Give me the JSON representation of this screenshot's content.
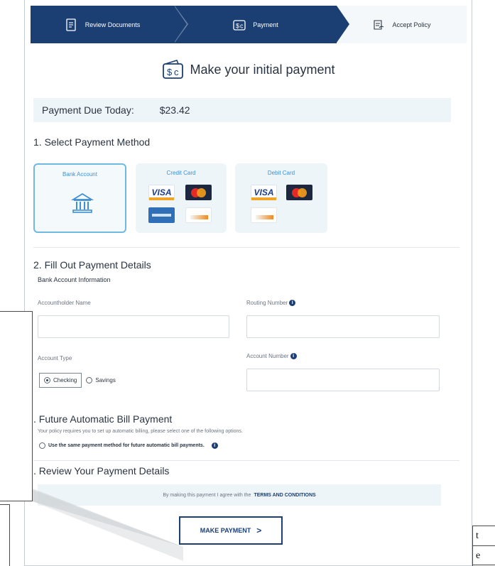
{
  "stepper": {
    "steps": [
      {
        "label": "Review Documents",
        "icon": "document-icon"
      },
      {
        "label": "Payment",
        "icon": "payment-icon"
      },
      {
        "label": "Accept Policy",
        "icon": "policy-icon"
      }
    ],
    "active_color": "#1b3f73"
  },
  "header": {
    "title": "Make your initial payment",
    "icon": "wallet-dollar-icon"
  },
  "due": {
    "label": "Payment Due Today:",
    "amount": "$23.42"
  },
  "section1": {
    "title": "1. Select Payment Method",
    "methods": [
      {
        "label": "Bank Account",
        "icon": "bank-icon",
        "selected": true
      },
      {
        "label": "Credit Card",
        "logos": [
          "visa",
          "mastercard",
          "amex",
          "discover"
        ],
        "selected": false
      },
      {
        "label": "Debit Card",
        "logos": [
          "visa",
          "mastercard",
          "discover"
        ],
        "selected": false
      }
    ]
  },
  "section2": {
    "title": "2. Fill Out Payment Details",
    "subtitle": "Bank Account Information",
    "accountholder_label": "Accountholder Name",
    "routing_label": "Routing Number",
    "account_type_label": "Account Type",
    "account_number_label": "Account Number",
    "account_types": [
      {
        "label": "Checking",
        "selected": true
      },
      {
        "label": "Savings",
        "selected": false
      }
    ]
  },
  "section3": {
    "title": ". Future Automatic Bill Payment",
    "description": "Your policy requires you to set up automatic billing, please select one of the following options.",
    "option": "Use the same payment method for future automatic bill payments."
  },
  "section4": {
    "title": ". Review Your Payment Details",
    "terms_prefix": "By making this payment I agree with the",
    "terms_link": "TERMS AND CONDITIONS"
  },
  "submit": {
    "label": "MAKE PAYMENT",
    "arrow": ">"
  },
  "edge_fragments": [
    "t",
    "e"
  ],
  "colors": {
    "brand_navy": "#1b3f73",
    "accent_blue": "#3f8fd1",
    "panel_bg": "#eef5f9"
  }
}
